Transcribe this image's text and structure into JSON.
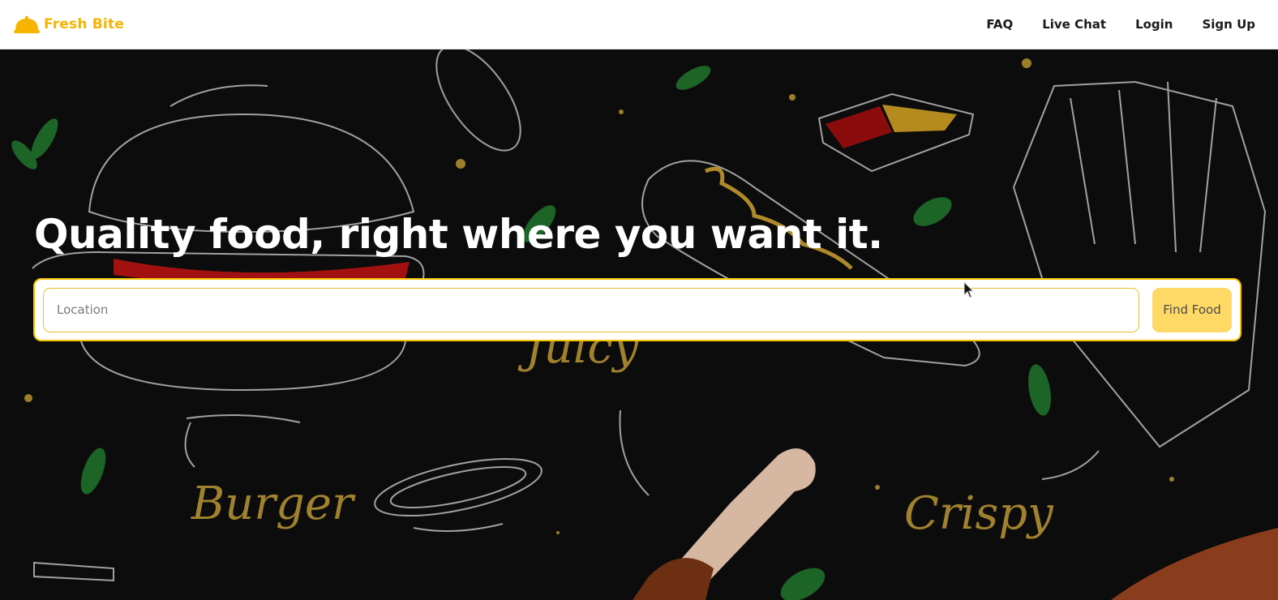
{
  "brand": {
    "name": "Fresh Bite",
    "icon": "cloche-icon",
    "color": "#f6b400"
  },
  "nav": {
    "items": [
      {
        "label": "FAQ"
      },
      {
        "label": "Live Chat"
      },
      {
        "label": "Login"
      },
      {
        "label": "Sign Up"
      }
    ]
  },
  "hero": {
    "headline": "Quality food, right where you want it.",
    "search": {
      "placeholder": "Location",
      "value": "",
      "button_label": "Find Food"
    },
    "doodle_words": [
      "Juicy",
      "Burger",
      "Crispy"
    ]
  },
  "colors": {
    "accent": "#f5c200",
    "button_bg": "#ffd966",
    "hero_bg": "#0c0c0c",
    "doodle_text": "#a0812e"
  }
}
